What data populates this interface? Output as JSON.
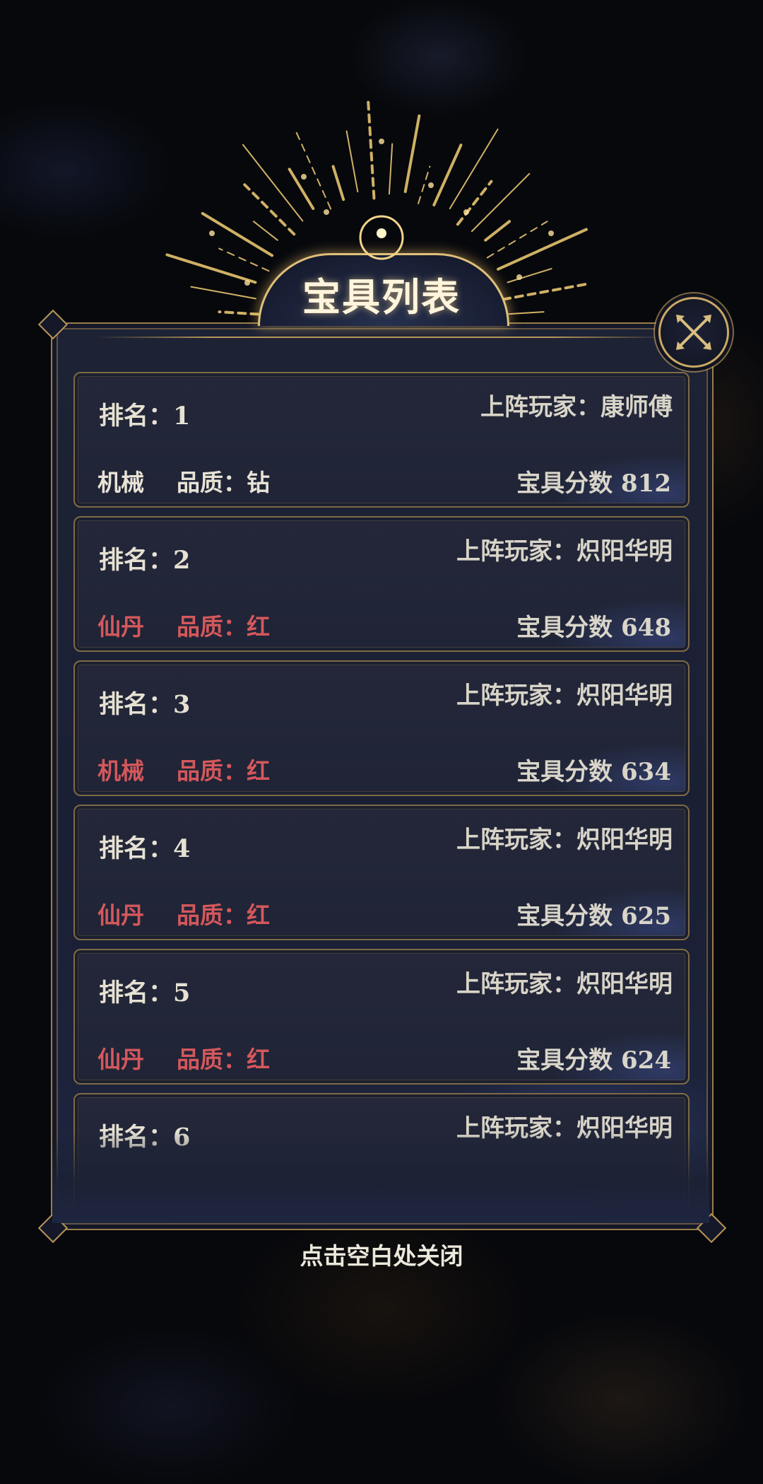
{
  "dialog": {
    "title": "宝具列表",
    "close_hint": "点击空白处关闭"
  },
  "colors": {
    "gold": "#c9a766",
    "text_white": "#e8e3d6",
    "text_red": "#d4585c",
    "panel_bg": "#1d2235"
  },
  "icons": {
    "close": "close-x-icon",
    "title_emblem": "crescent-moon-icon"
  },
  "list": {
    "items": [
      {
        "rank": "排名：1",
        "player": "上阵玩家：康师傅",
        "category": "机械",
        "quality": "品质：钻",
        "score": "宝具分数 812",
        "tone": "white"
      },
      {
        "rank": "排名：2",
        "player": "上阵玩家：炽阳华明",
        "category": "仙丹",
        "quality": "品质：红",
        "score": "宝具分数 648",
        "tone": "red"
      },
      {
        "rank": "排名：3",
        "player": "上阵玩家：炽阳华明",
        "category": "机械",
        "quality": "品质：红",
        "score": "宝具分数 634",
        "tone": "red"
      },
      {
        "rank": "排名：4",
        "player": "上阵玩家：炽阳华明",
        "category": "仙丹",
        "quality": "品质：红",
        "score": "宝具分数 625",
        "tone": "red"
      },
      {
        "rank": "排名：5",
        "player": "上阵玩家：炽阳华明",
        "category": "仙丹",
        "quality": "品质：红",
        "score": "宝具分数 624",
        "tone": "red"
      },
      {
        "rank": "排名：6",
        "player": "上阵玩家：炽阳华明",
        "category": "",
        "quality": "",
        "score": "",
        "tone": "red"
      }
    ]
  }
}
